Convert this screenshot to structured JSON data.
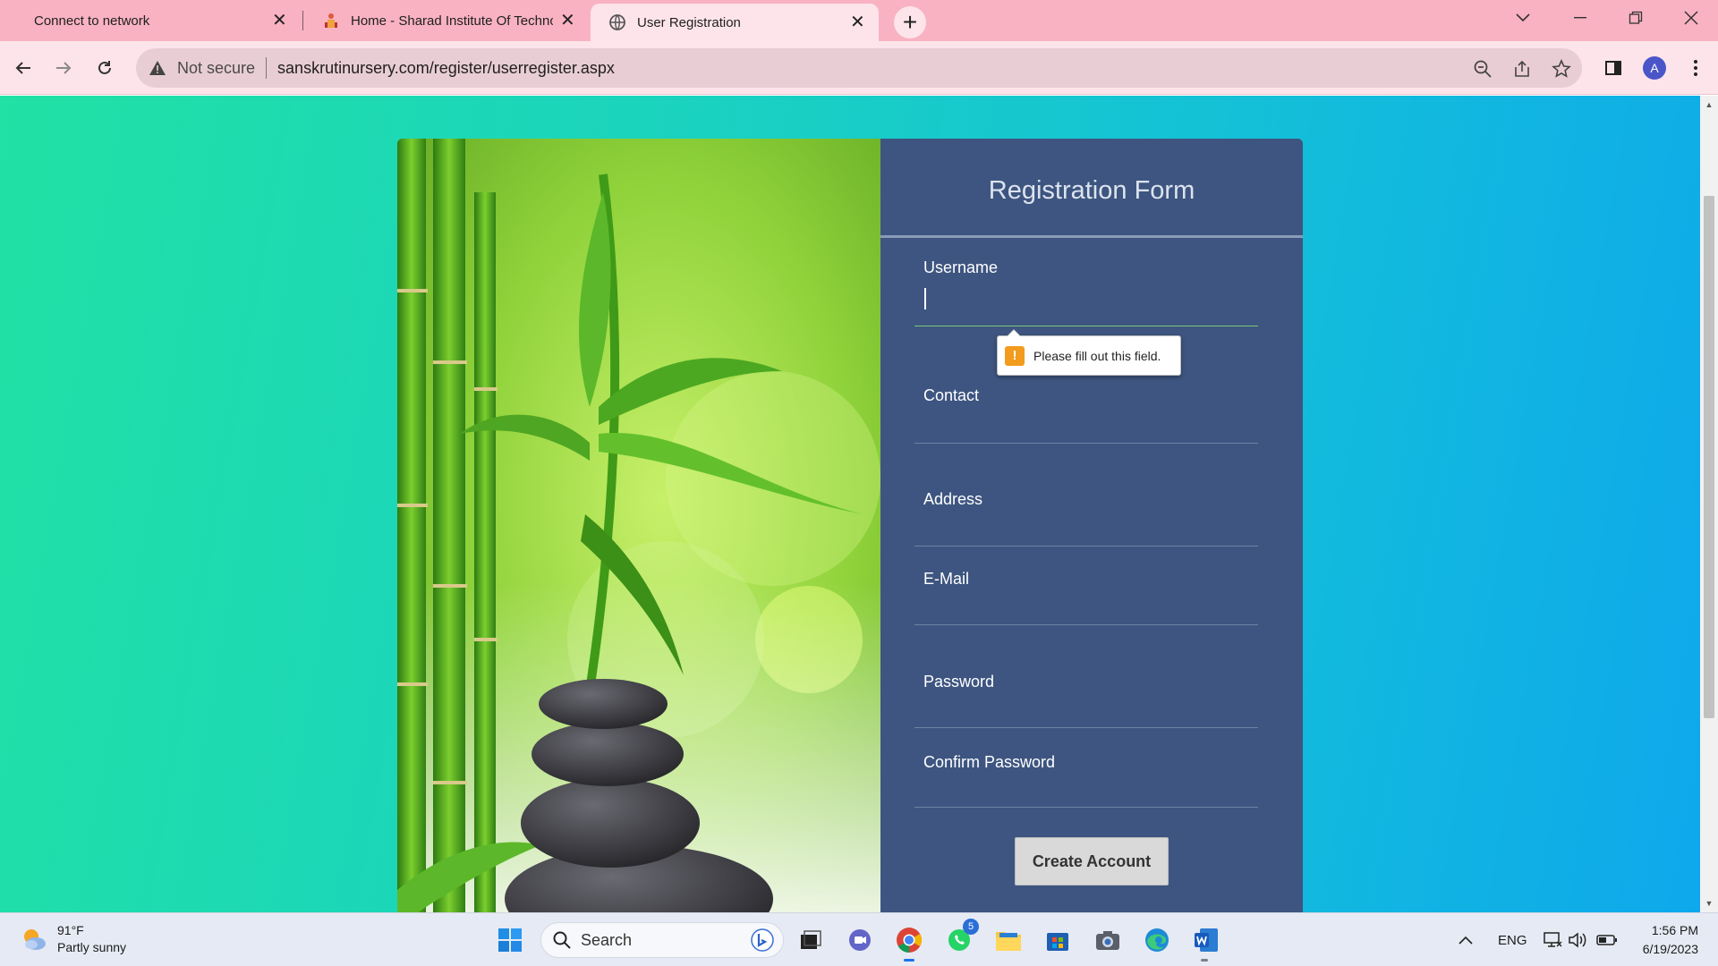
{
  "browser": {
    "tabs": [
      {
        "title": "Connect to network",
        "active": false
      },
      {
        "title": "Home - Sharad Institute Of Technology",
        "active": false
      },
      {
        "title": "User Registration",
        "active": true
      }
    ],
    "security_label": "Not secure",
    "url": "sanskrutinursery.com/register/userregister.aspx",
    "profile_initial": "A"
  },
  "form": {
    "title": "Registration Form",
    "fields": [
      {
        "label": "Username",
        "value": ""
      },
      {
        "label": "Contact",
        "value": ""
      },
      {
        "label": "Address",
        "value": ""
      },
      {
        "label": "E-Mail",
        "value": ""
      },
      {
        "label": "Password",
        "value": ""
      },
      {
        "label": "Confirm Password",
        "value": ""
      }
    ],
    "validation_message": "Please fill out this field.",
    "submit_label": "Create Account"
  },
  "taskbar": {
    "weather_temp": "91°F",
    "weather_desc": "Partly sunny",
    "search_label": "Search",
    "whatsapp_badge": "5",
    "language": "ENG",
    "time": "1:56 PM",
    "date": "6/19/2023"
  },
  "colors": {
    "tabstrip": "#f8b2c2",
    "toolbar": "#fde4ea",
    "form_panel": "#3d5580",
    "gradient_start": "#21e1a4",
    "gradient_end": "#0ea8ec",
    "focus_underline": "#7dc87a"
  }
}
